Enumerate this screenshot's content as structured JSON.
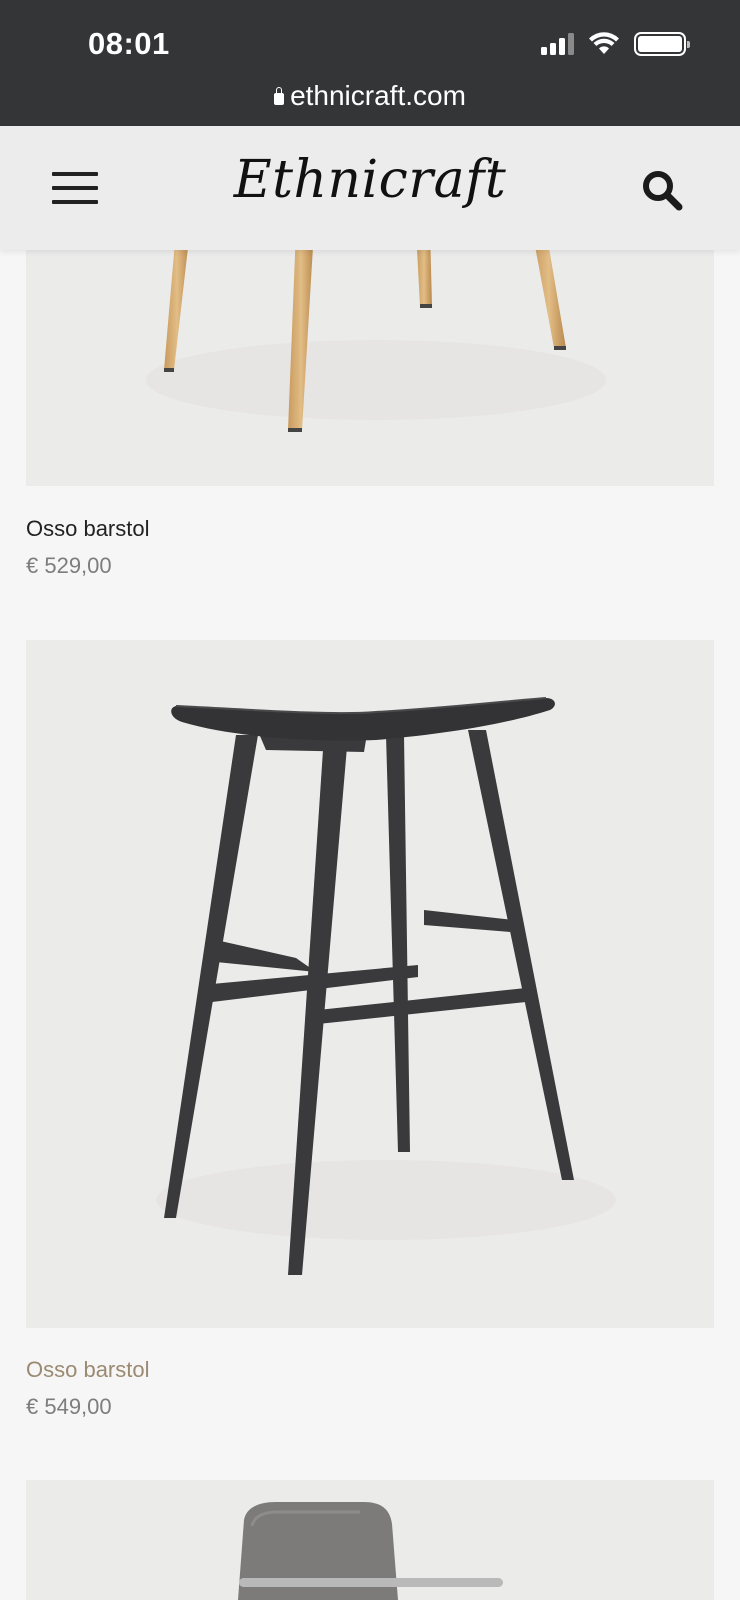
{
  "status_bar": {
    "time": "08:01"
  },
  "browser": {
    "url": "ethnicraft.com"
  },
  "header": {
    "logo": "Ethnicraft"
  },
  "products": [
    {
      "name": "Osso barstol",
      "price": "€ 529,00",
      "finish": "natural oak",
      "highlighted": false
    },
    {
      "name": "Osso barstol",
      "price": "€ 549,00",
      "finish": "black",
      "highlighted": true
    }
  ],
  "colors": {
    "status_bar_bg": "#343537",
    "header_bg": "#ececec",
    "page_bg": "#f6f6f6",
    "accent_text": "#9b8a72",
    "price_text": "#7d7d7d"
  },
  "icons": [
    "lock-icon",
    "hamburger-menu-icon",
    "search-icon",
    "signal-icon",
    "wifi-icon",
    "battery-icon"
  ]
}
